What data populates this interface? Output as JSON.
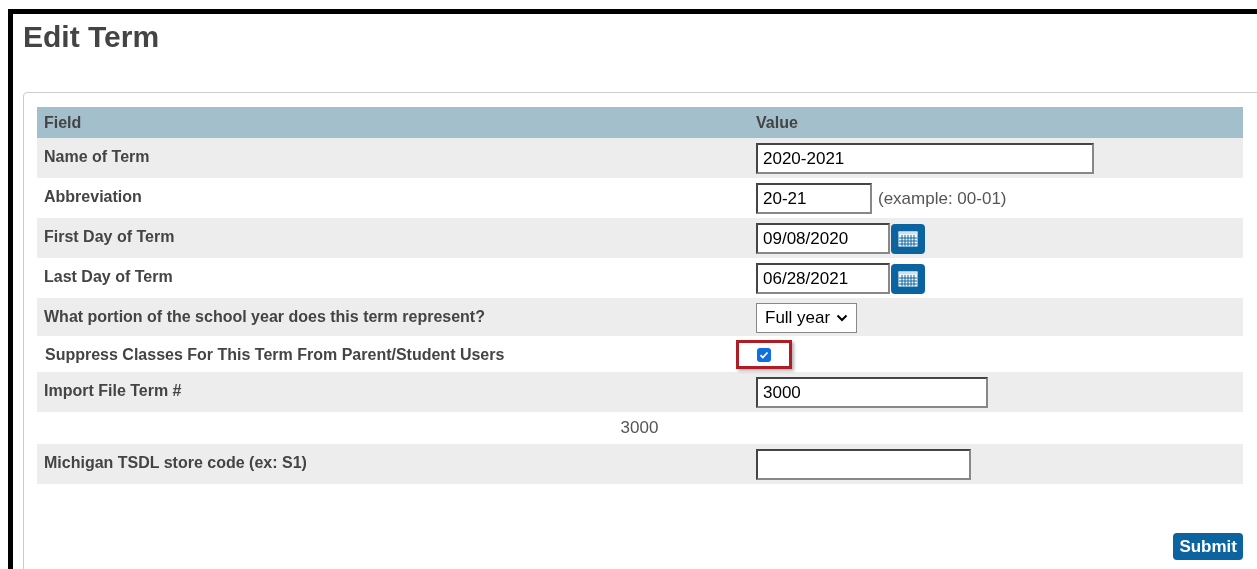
{
  "title": "Edit Term",
  "table": {
    "columns": [
      "Field",
      "Value"
    ],
    "rows": [
      {
        "kind": "text",
        "label": "Name of Term",
        "value": "2020-2021"
      },
      {
        "kind": "text",
        "label": "Abbreviation",
        "value": "20-21",
        "hint": "(example: 00-01)"
      },
      {
        "kind": "date",
        "label": "First Day of Term",
        "value": "09/08/2020"
      },
      {
        "kind": "date",
        "label": "Last Day of Term",
        "value": "06/28/2021"
      },
      {
        "kind": "select",
        "label": "What portion of the school year does this term represent?",
        "value": "Full year"
      },
      {
        "kind": "checkbox",
        "label": "Suppress Classes For This Term From Parent/Student Users",
        "checked": true,
        "highlighted": true
      },
      {
        "kind": "text",
        "label": "Import File Term #",
        "value": "3000"
      },
      {
        "kind": "note",
        "text": "3000"
      },
      {
        "kind": "text",
        "label": "Michigan TSDL store code (ex: S1)",
        "value": ""
      }
    ]
  },
  "submit": "Submit"
}
